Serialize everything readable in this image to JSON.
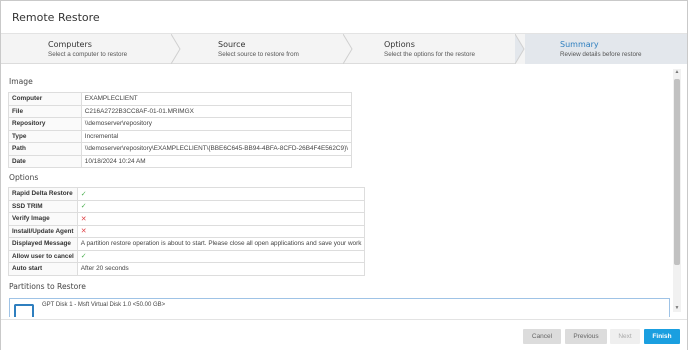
{
  "window": {
    "title": "Remote Restore"
  },
  "wizard": {
    "steps": [
      {
        "title": "Computers",
        "subtitle": "Select a computer to restore"
      },
      {
        "title": "Source",
        "subtitle": "Select source to restore from"
      },
      {
        "title": "Options",
        "subtitle": "Select the options for the restore"
      },
      {
        "title": "Summary",
        "subtitle": "Review details before restore"
      }
    ],
    "active_step": "Summary"
  },
  "image": {
    "heading": "Image",
    "rows": [
      {
        "label": "Computer",
        "value": "EXAMPLECLIENT"
      },
      {
        "label": "File",
        "value": "C216A2722B3CC8AF-01-01.MRIMGX"
      },
      {
        "label": "Repository",
        "value": "\\\\demoserver\\repository"
      },
      {
        "label": "Type",
        "value": "Incremental"
      },
      {
        "label": "Path",
        "value": "\\\\demoserver\\repository\\EXAMPLECLIENT\\{BBE6C645-BB94-4BFA-8CFD-26B4F4E562C9}\\"
      },
      {
        "label": "Date",
        "value": "10/18/2024 10:24 AM"
      }
    ]
  },
  "options": {
    "heading": "Options",
    "rows": [
      {
        "label": "Rapid Delta Restore",
        "value": "✓",
        "status": "check"
      },
      {
        "label": "SSD TRIM",
        "value": "✓",
        "status": "check"
      },
      {
        "label": "Verify Image",
        "value": "✕",
        "status": "cross"
      },
      {
        "label": "Install/Update Agent",
        "value": "✕",
        "status": "cross"
      },
      {
        "label": "Displayed Message",
        "value": "A partition restore operation is about to start. Please close all open applications and save your work",
        "status": "text"
      },
      {
        "label": "Allow user to cancel",
        "value": "✓",
        "status": "check"
      },
      {
        "label": "Auto start",
        "value": "After 20 seconds",
        "status": "text"
      }
    ]
  },
  "partitions": {
    "heading": "Partitions to Restore",
    "disk_label": "GPT Disk 1 - Msft Virtual Disk 1.0 <50.00 GB>",
    "disk_icon": "disk-icon"
  },
  "footer": {
    "cancel_label": "Cancel",
    "previous_label": "Previous",
    "next_label": "Next",
    "finish_label": "Finish"
  },
  "colors": {
    "accent": "#1a9fe0",
    "active_step": "#2f7fbf",
    "check": "#4caf50",
    "cross": "#e0454a"
  }
}
